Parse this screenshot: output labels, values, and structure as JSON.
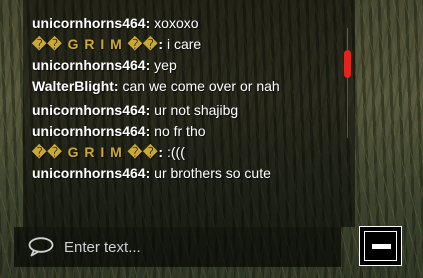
{
  "chat": {
    "messages": [
      {
        "user": "unicornhorns464",
        "text": "xoxoxo",
        "style": "normal"
      },
      {
        "user": "�� G R I M ��",
        "text": "i care",
        "style": "grim"
      },
      {
        "user": "unicornhorns464",
        "text": "yep",
        "style": "normal"
      },
      {
        "user": "WalterBlight",
        "text": "can we come over or nah",
        "style": "normal"
      },
      {
        "user": "unicornhorns464",
        "text": "ur not shajibg",
        "style": "normal"
      },
      {
        "user": "unicornhorns464",
        "text": "no fr tho",
        "style": "normal"
      },
      {
        "user": "�� G R I M ��",
        "text": ":(((",
        "style": "grim"
      },
      {
        "user": "unicornhorns464",
        "text": "ur brothers so cute",
        "style": "normal"
      }
    ],
    "separator": ":",
    "input_placeholder": "Enter text...",
    "scroll_thumb_color": "#e2241b",
    "grim_name_color": "#c9a834"
  }
}
